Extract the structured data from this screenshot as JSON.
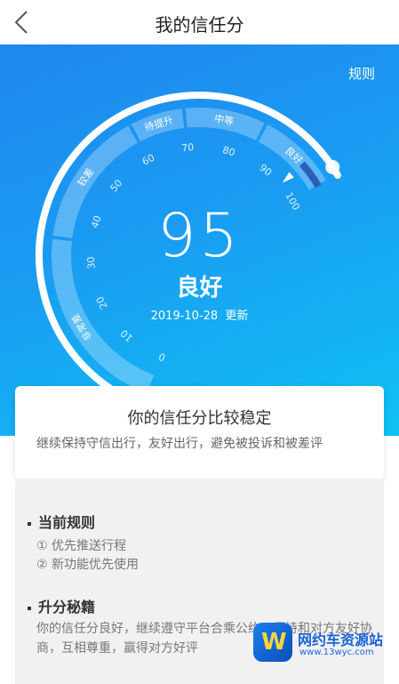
{
  "header": {
    "title": "我的信任分",
    "back_icon": "chevron-left-icon"
  },
  "hero": {
    "rules_link": "规则",
    "score": "95",
    "level": "良好",
    "date": "2019-10-28",
    "updated_label": "更新",
    "score_value": 95,
    "score_max": 100,
    "bands": [
      {
        "label": "非常差",
        "from": 0,
        "to": 35
      },
      {
        "label": "较差",
        "from": 35,
        "to": 60
      },
      {
        "label": "待提升",
        "from": 60,
        "to": 70
      },
      {
        "label": "中等",
        "from": 70,
        "to": 85
      },
      {
        "label": "良好",
        "from": 85,
        "to": 100
      }
    ],
    "ticks": [
      "0",
      "10",
      "20",
      "30",
      "40",
      "50",
      "60",
      "70",
      "80",
      "90",
      "100"
    ]
  },
  "card": {
    "title": "你的信任分比较稳定",
    "description": "继续保持守信出行，友好出行，避免被投诉和被差评"
  },
  "current_rules": {
    "title": "当前规则",
    "items": [
      "① 优先推送行程",
      "② 新功能优先使用"
    ]
  },
  "tips": {
    "title": "升分秘籍",
    "text": "你的信任分良好，继续遵守平台合乘公约，保持和对方友好协商，互相尊重，赢得对方好评"
  },
  "watermark": {
    "name": "网约车资源站",
    "url": "www.13wyc.com"
  },
  "colors": {
    "hero_top": "#1f86ef",
    "hero_bottom": "#0fc1f4",
    "dark_segment": "#2a5fb8"
  }
}
